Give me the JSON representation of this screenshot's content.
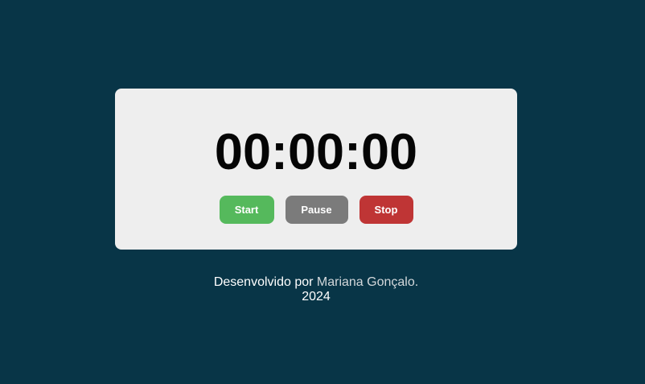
{
  "timer": {
    "display": "00:00:00"
  },
  "controls": {
    "start_label": "Start",
    "pause_label": "Pause",
    "stop_label": "Stop"
  },
  "footer": {
    "prefix": "Desenvolvido por",
    "author": "Mariana Gonçalo.",
    "year": "2024"
  },
  "colors": {
    "page_background": "#083547",
    "card_background": "#eeeeee",
    "start": "#55b95c",
    "pause": "#7b7b7b",
    "stop": "#bf3535"
  }
}
